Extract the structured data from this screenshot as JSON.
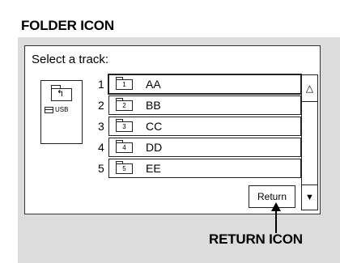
{
  "callouts": {
    "folder_icon": "FOLDER ICON",
    "return_icon": "RETURN ICON"
  },
  "screen": {
    "title": "Select a track:",
    "folder_panel": {
      "up_folder_icon": "folder-up-icon",
      "usb_label": "USB"
    },
    "tracks": [
      {
        "num": "1",
        "folder_num": "1",
        "name": "AA",
        "selected": true
      },
      {
        "num": "2",
        "folder_num": "2",
        "name": "BB",
        "selected": false
      },
      {
        "num": "3",
        "folder_num": "3",
        "name": "CC",
        "selected": false
      },
      {
        "num": "4",
        "folder_num": "4",
        "name": "DD",
        "selected": false
      },
      {
        "num": "5",
        "folder_num": "5",
        "name": "EE",
        "selected": false
      }
    ],
    "scroll_up_glyph": "△",
    "scroll_down_glyph": "▼",
    "return_label": "Return"
  }
}
